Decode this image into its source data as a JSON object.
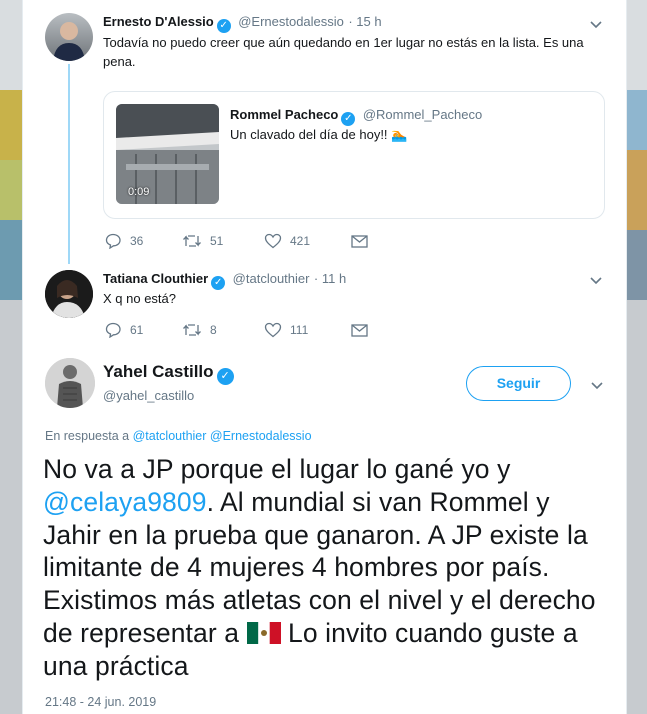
{
  "reply1": {
    "name": "Ernesto D'Alessio",
    "handle": "@Ernestodalessio",
    "time": "· 15 h",
    "text": "Todavía no puedo creer que aún quedando en 1er lugar no estás en la lista. Es una pena.",
    "quote": {
      "name": "Rommel Pacheco",
      "handle": "@Rommel_Pacheco",
      "text": "Un clavado del día de hoy!! 🏊",
      "video_time": "0:09"
    },
    "replies": "36",
    "retweets": "51",
    "likes": "421"
  },
  "reply2": {
    "name": "Tatiana Clouthier",
    "handle": "@tatclouthier",
    "time": "· 11 h",
    "text": "X q no está?",
    "replies": "61",
    "retweets": "8",
    "likes": "111"
  },
  "main": {
    "name": "Yahel Castillo",
    "handle": "@yahel_castillo",
    "follow_label": "Seguir",
    "reply_prefix": "En respuesta a",
    "reply_mention_1": "@tatclouthier",
    "reply_mention_2": "@Ernestodalessio",
    "text_part1": "No va a JP porque el lugar lo gané yo y ",
    "text_mention": "@celaya9809",
    "text_part2": ". Al mundial si van Rommel y Jahir en la prueba que ganaron. A JP existe la limitante de 4 mujeres 4 hombres por país. Existimos más atletas con el nivel y el derecho de representar a ",
    "text_part3": " Lo invito cuando guste a una práctica",
    "timestamp": "21:48 - 24 jun. 2019"
  },
  "colors": {
    "accent": "#1da1f2",
    "thread": "#9fd8f7",
    "muted": "#657786"
  }
}
